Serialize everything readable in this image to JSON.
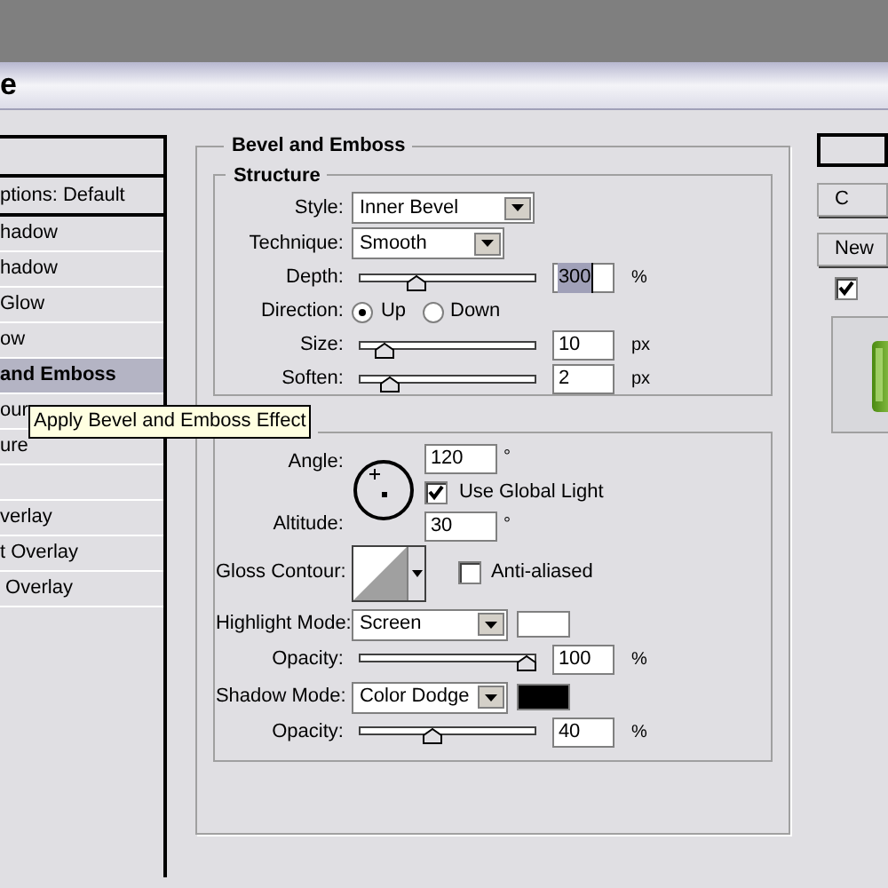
{
  "window": {
    "title": "e"
  },
  "styles_list": {
    "items": [
      {
        "label": "ptions: Default",
        "selected": false
      },
      {
        "label": "hadow",
        "selected": false
      },
      {
        "label": "hadow",
        "selected": false
      },
      {
        "label": "Glow",
        "selected": false
      },
      {
        "label": "ow",
        "selected": false
      },
      {
        "label": "and Emboss",
        "selected": true
      },
      {
        "label": "our",
        "selected": false
      },
      {
        "label": "ure",
        "selected": false
      },
      {
        "selected": false
      },
      {
        "label": "verlay",
        "selected": false
      },
      {
        "label": "t Overlay",
        "selected": false
      },
      {
        "label": " Overlay",
        "selected": false
      }
    ]
  },
  "tooltip": "Apply Bevel and Emboss Effect",
  "bevel_and_emboss": {
    "title": "Bevel and Emboss",
    "structure": {
      "title": "Structure",
      "style": {
        "label": "Style:",
        "value": "Inner Bevel"
      },
      "technique": {
        "label": "Technique:",
        "value": "Smooth"
      },
      "depth": {
        "label": "Depth:",
        "value": "300",
        "unit": "%",
        "level": 0.3,
        "highlighted": true
      },
      "direction": {
        "label": "Direction:",
        "options": [
          {
            "label": "Up",
            "selected": true
          },
          {
            "label": "Down",
            "selected": false
          }
        ]
      },
      "size": {
        "label": "Size:",
        "value": "10",
        "unit": "px",
        "level": 0.1,
        "highlighted": false
      },
      "soften": {
        "label": "Soften:",
        "value": "2",
        "unit": "px",
        "level": 0.13,
        "highlighted": false
      }
    },
    "shading": {
      "angle": {
        "label": "Angle:",
        "value": "120",
        "unit": "°"
      },
      "use_global_light": {
        "label": "Use Global Light",
        "checked": true
      },
      "altitude": {
        "label": "Altitude:",
        "value": "30",
        "unit": "°"
      },
      "gloss_contour": {
        "label": "Gloss Contour:"
      },
      "anti_aliased": {
        "label": "Anti-aliased",
        "checked": false
      },
      "highlight_mode": {
        "label": "Highlight Mode:",
        "value": "Screen",
        "color": "#ffffff"
      },
      "highlight_opacity": {
        "label": "Opacity:",
        "value": "100",
        "unit": "%",
        "level": 1.0,
        "highlighted": false
      },
      "shadow_mode": {
        "label": "Shadow Mode:",
        "value": "Color Dodge",
        "color": "#000000"
      },
      "shadow_opacity": {
        "label": "Opacity:",
        "value": "40",
        "unit": "%",
        "level": 0.4,
        "highlighted": false
      }
    }
  },
  "buttons": [
    {
      "default": true
    },
    {
      "label": "C",
      "default": false
    },
    {
      "label": "New",
      "default": false
    }
  ],
  "preview": {
    "checked": true
  }
}
